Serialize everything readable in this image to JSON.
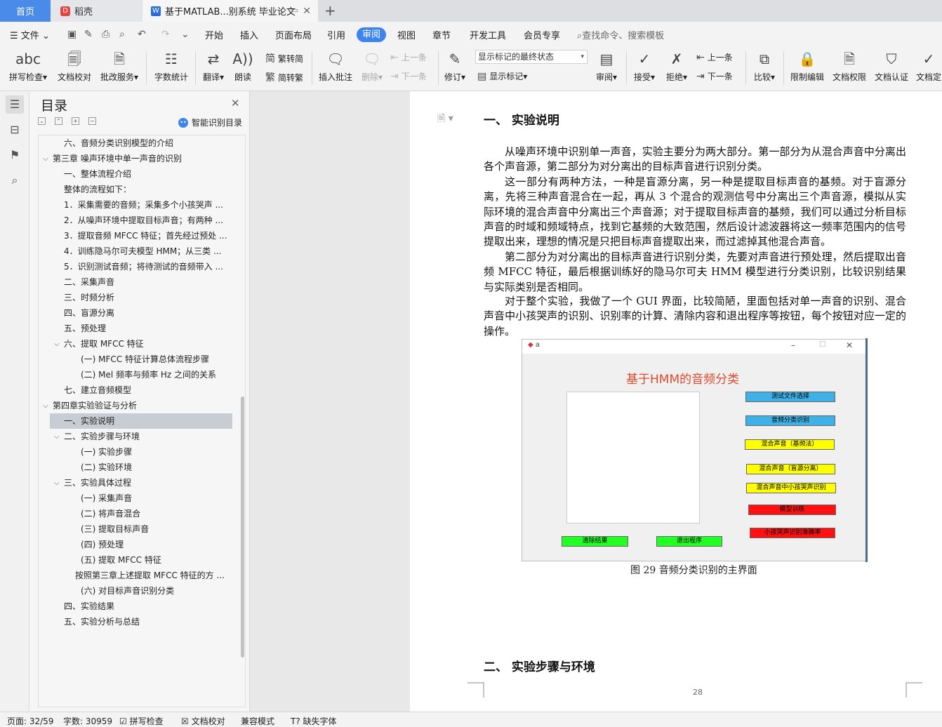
{
  "tabs": {
    "home": "首页",
    "daoke": "稻壳",
    "doc": "基于MATLAB...别系统 毕业论文"
  },
  "menu": {
    "file": "文件",
    "items": [
      "开始",
      "插入",
      "页面布局",
      "引用",
      "审阅",
      "视图",
      "章节",
      "开发工具",
      "会员专享"
    ],
    "active": "审阅",
    "search": "查找命令、搜索模板"
  },
  "ribbon": {
    "spellcheck": "拼写检查",
    "doccheck": "文档校对",
    "batch": "批改服务",
    "wordcount": "字数统计",
    "translate": "翻译",
    "read": "朗读",
    "trad": "繁转简",
    "simp": "简转繁",
    "insert_comment": "插入批注",
    "delete": "删除",
    "prev": "上一条",
    "next": "下一条",
    "revise": "修订",
    "markup_state": "显示标记的最终状态",
    "show_markup": "显示标记",
    "review": "审阅",
    "accept": "接受",
    "reject": "拒绝",
    "prev2": "上一条",
    "next2": "下一条",
    "compare": "比较",
    "restrict": "限制编辑",
    "doc_rights": "文档权限",
    "doc_auth": "文档认证",
    "doc_final": "文档定"
  },
  "toc": {
    "title": "目录",
    "ai_label": "智能识别目录",
    "items": [
      {
        "text": "六、音频分类识别模型的介绍",
        "level": 1,
        "caret": ""
      },
      {
        "text": "第三章 噪声环境中单一声音的识别",
        "level": 0,
        "caret": "v"
      },
      {
        "text": "一、整体流程介绍",
        "level": 1,
        "caret": ""
      },
      {
        "text": "整体的流程如下：",
        "level": 1,
        "caret": ""
      },
      {
        "text": "1．采集需要的音频；采集多个小孩哭声 ...",
        "level": 1,
        "caret": ""
      },
      {
        "text": "2．从噪声环境中提取目标声音；有两种 ...",
        "level": 1,
        "caret": ""
      },
      {
        "text": "3．提取音频 MFCC 特征；首先经过预处 ...",
        "level": 1,
        "caret": ""
      },
      {
        "text": "4．训练隐马尔可夫模型 HMM；从三类 ...",
        "level": 1,
        "caret": ""
      },
      {
        "text": "5．识别测试音频；将待测试的音频带入 ...",
        "level": 1,
        "caret": ""
      },
      {
        "text": "二、采集声音",
        "level": 1,
        "caret": ""
      },
      {
        "text": "三、时频分析",
        "level": 1,
        "caret": ""
      },
      {
        "text": "四、盲源分离",
        "level": 1,
        "caret": ""
      },
      {
        "text": "五、预处理",
        "level": 1,
        "caret": ""
      },
      {
        "text": "六、提取 MFCC 特征",
        "level": 1,
        "caret": "v"
      },
      {
        "text": "(一) MFCC 特征计算总体流程步骤",
        "level": 2,
        "caret": ""
      },
      {
        "text": "(二) Mel 频率与频率 Hz 之间的关系",
        "level": 2,
        "caret": ""
      },
      {
        "text": "七、建立音频模型",
        "level": 1,
        "caret": ""
      },
      {
        "text": "第四章实验验证与分析",
        "level": 0,
        "caret": "v"
      },
      {
        "text": "一、实验说明",
        "level": 1,
        "caret": "",
        "selected": true
      },
      {
        "text": "二、实验步骤与环境",
        "level": 1,
        "caret": "v"
      },
      {
        "text": "(一) 实验步骤",
        "level": 2,
        "caret": ""
      },
      {
        "text": "(二) 实验环境",
        "level": 2,
        "caret": ""
      },
      {
        "text": "三、实验具体过程",
        "level": 1,
        "caret": "v"
      },
      {
        "text": "(一) 采集声音",
        "level": 2,
        "caret": ""
      },
      {
        "text": "(二) 将声音混合",
        "level": 2,
        "caret": ""
      },
      {
        "text": "(三) 提取目标声音",
        "level": 2,
        "caret": ""
      },
      {
        "text": "(四) 预处理",
        "level": 2,
        "caret": ""
      },
      {
        "text": "(五) 提取 MFCC 特征",
        "level": 2,
        "caret": ""
      },
      {
        "text": "按照第三章上述提取 MFCC 特征的方 ...",
        "level": 3,
        "caret": ""
      },
      {
        "text": "(六) 对目标声音识别分类",
        "level": 2,
        "caret": ""
      },
      {
        "text": "四、实验结果",
        "level": 1,
        "caret": ""
      },
      {
        "text": "五、实验分析与总结",
        "level": 1,
        "caret": ""
      }
    ]
  },
  "doc": {
    "heading1": "一、  实验说明",
    "paragraphs": [
      "从噪声环境中识别单一声音，实验主要分为两大部分。第一部分为从混合声音中分离出各个声音源，第二部分为对分离出的目标声音进行识别分类。",
      "这一部分有两种方法，一种是盲源分离，另一种是提取目标声音的基频。对于盲源分离，先将三种声音混合在一起，再从 3 个混合的观测信号中分离出三个声音源，模拟从实际环境的混合声音中分离出三个声音源；对于提取目标声音的基频，我们可以通过分析目标声音的时域和频域特点，找到它基频的大致范围，然后设计滤波器将这一频率范围内的信号提取出来，理想的情况是只把目标声音提取出来，而过滤掉其他混合声音。",
      "第二部分为对分离出的目标声音进行识别分类，先要对声音进行预处理，然后提取出音频 MFCC 特征，最后根据训练好的隐马尔可夫 HMM 模型进行分类识别，比较识别结果与实际类别是否相同。",
      "对于整个实验，我做了一个 GUI 界面，比较简陋，里面包括对单一声音的识别、混合声音中小孩哭声的识别、识别率的计算、清除内容和退出程序等按钮，每个按钮对应一定的操作。"
    ],
    "caption": "图 29 音频分类识别的主界面",
    "heading2": "二、  实验步骤与环境",
    "page_number": "28"
  },
  "gui": {
    "window_title": "a",
    "title": "基于HMM的音频分类",
    "buttons": {
      "test_file": "测试文件选择",
      "classify": "音频分类识别",
      "mix_pitch": "混合声音（基频法）",
      "mix_bss": "混合声音（盲源分离）",
      "mix_baby": "混合声音中小孩哭声识别",
      "train": "模型训练",
      "baby_rate": "小孩哭声识别准确率",
      "clear": "清除结果",
      "exit": "退出程序"
    }
  },
  "status": {
    "page": "页面: 32/59",
    "words": "字数: 30959",
    "spell": "拼写检查",
    "proof": "文档校对",
    "compat": "兼容模式",
    "missing_font": "缺失字体"
  }
}
